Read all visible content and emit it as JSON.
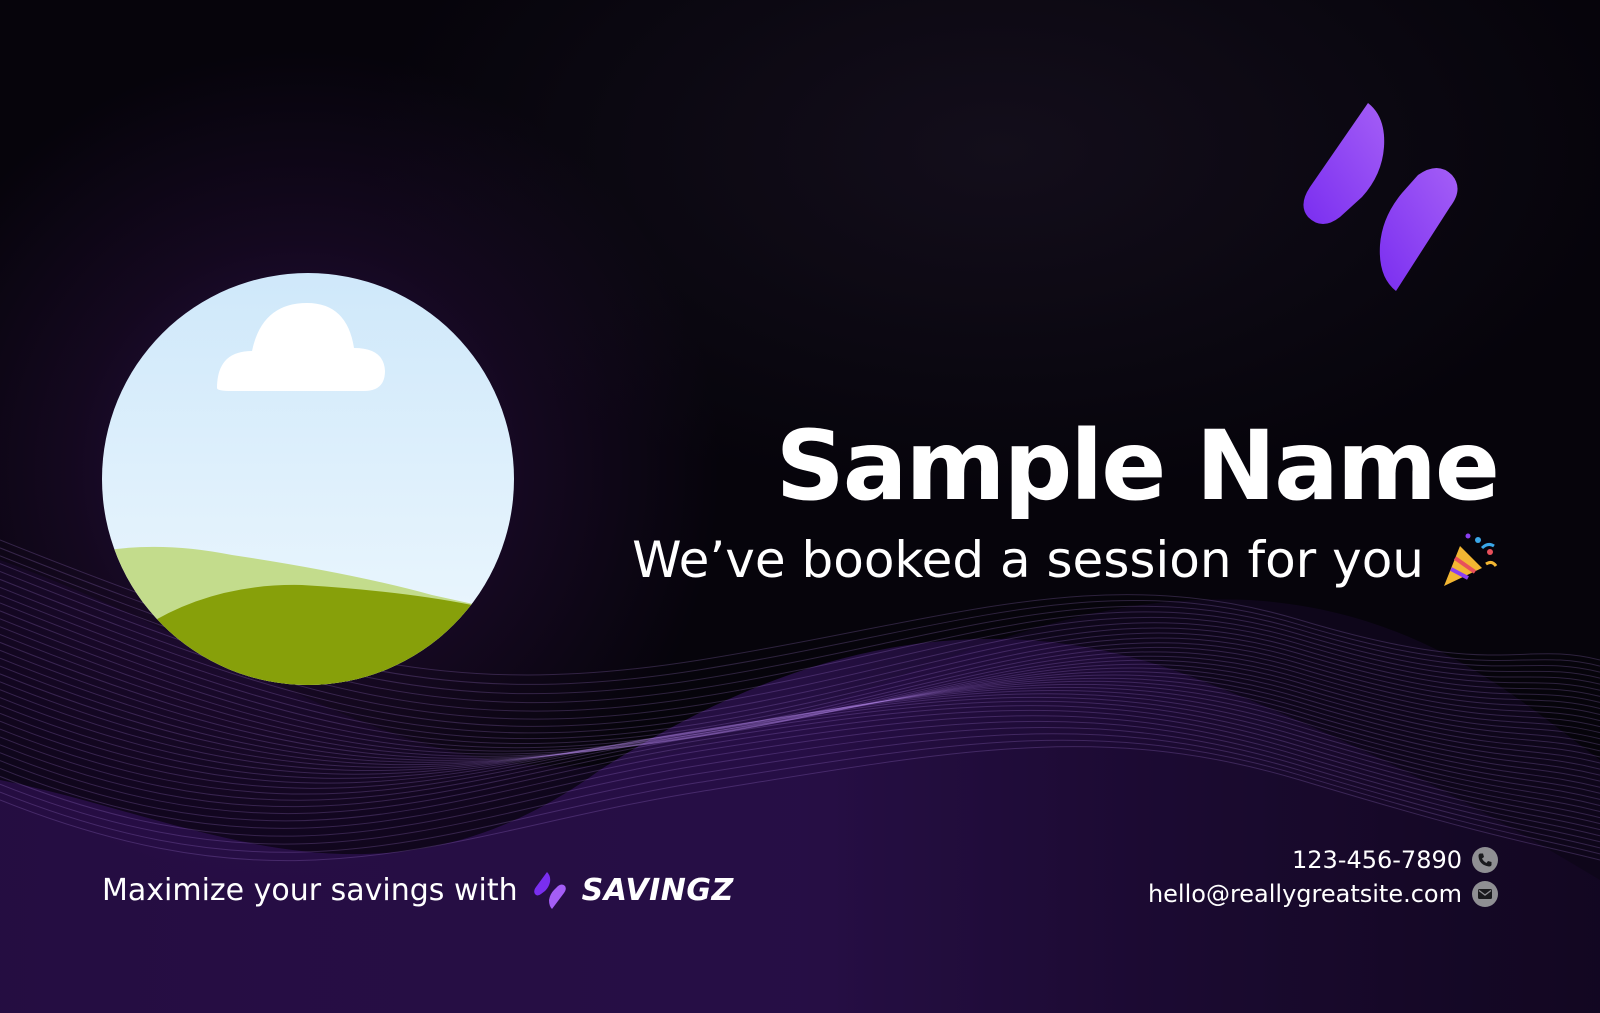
{
  "card": {
    "name": "Sample Name",
    "subtitle": "We’ve booked a session for you",
    "subtitle_icon": "party-popper-icon",
    "tagline": "Maximize your savings with",
    "brand": "SAVINGZ",
    "phone": "123-456-7890",
    "email": "hello@reallygreatsite.com",
    "phone_icon": "phone-icon",
    "email_icon": "mail-icon",
    "photo": "landscape-photo-placeholder",
    "logo": "savingz-logo-mark"
  },
  "colors": {
    "background": "#06040b",
    "accent_purple": "#8a3ff0",
    "accent_purple_light": "#a65cf5",
    "sky": "#d6edfb",
    "grass_dark": "#87a00a",
    "grass_light": "#c3dc8c",
    "text": "#ffffff",
    "icon_gray": "#8f8f93"
  }
}
